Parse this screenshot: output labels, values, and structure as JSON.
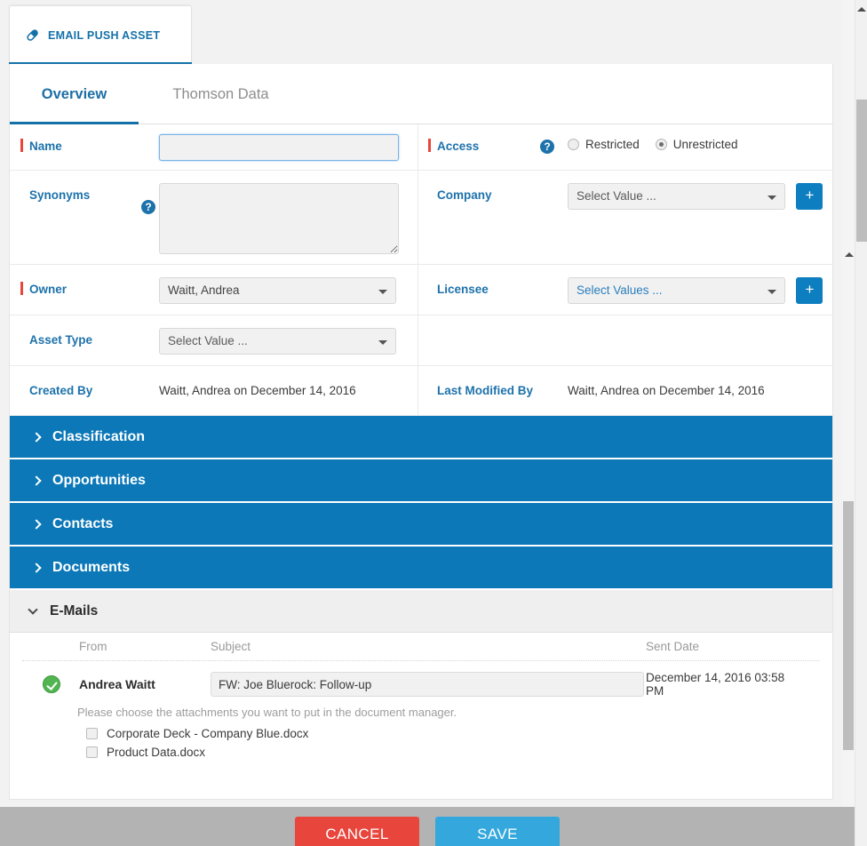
{
  "asset_tab": {
    "label": "EMAIL PUSH ASSET",
    "icon": "pill-icon"
  },
  "tabs": [
    {
      "label": "Overview",
      "active": true
    },
    {
      "label": "Thomson Data",
      "active": false
    }
  ],
  "form": {
    "name": {
      "label": "Name",
      "value": "",
      "required": true
    },
    "access": {
      "label": "Access",
      "required": true,
      "help_icon": "?",
      "options": [
        {
          "label": "Restricted",
          "selected": false
        },
        {
          "label": "Unrestricted",
          "selected": true
        }
      ]
    },
    "synonyms": {
      "label": "Synonyms",
      "value": "",
      "help_icon": "?"
    },
    "company": {
      "label": "Company",
      "value": "Select Value ...",
      "add_label": "+"
    },
    "owner": {
      "label": "Owner",
      "value": "Waitt, Andrea",
      "required": true
    },
    "licensee": {
      "label": "Licensee",
      "value": "Select Values ...",
      "add_label": "+"
    },
    "asset_type": {
      "label": "Asset Type",
      "value": "Select Value ..."
    },
    "created_by": {
      "label": "Created By",
      "value": "Waitt, Andrea on December 14, 2016"
    },
    "last_modified_by": {
      "label": "Last Modified By",
      "value": "Waitt, Andrea on December 14, 2016"
    }
  },
  "sections": [
    {
      "title": "Classification",
      "expanded": false
    },
    {
      "title": "Opportunities",
      "expanded": false
    },
    {
      "title": "Contacts",
      "expanded": false
    },
    {
      "title": "Documents",
      "expanded": false
    },
    {
      "title": "E-Mails",
      "expanded": true
    }
  ],
  "emails": {
    "columns": {
      "from": "From",
      "subject": "Subject",
      "sent_date": "Sent Date"
    },
    "rows": [
      {
        "status_icon": "check-circle-icon",
        "from": "Andrea Waitt",
        "subject": "FW: Joe Bluerock: Follow-up",
        "sent_date": "December 14, 2016 03:58 PM",
        "attachments_note": "Please choose the attachments you want to put in the document manager.",
        "attachments": [
          {
            "name": "Corporate Deck - Company Blue.docx",
            "checked": false
          },
          {
            "name": "Product Data.docx",
            "checked": false
          }
        ]
      }
    ]
  },
  "footer": {
    "cancel_label": "CANCEL",
    "save_label": "SAVE"
  },
  "colors": {
    "accent_blue": "#0c78b8",
    "label_blue": "#1d72ab",
    "required_red": "#e8463c",
    "save_blue": "#34a8dd",
    "cancel_red": "#e8463c",
    "status_green": "#52b552"
  }
}
